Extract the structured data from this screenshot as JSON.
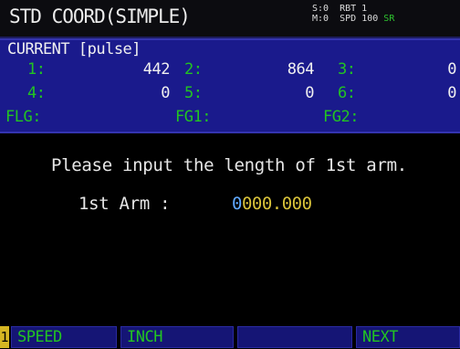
{
  "window": {
    "title": "STD COORD(SIMPLE)"
  },
  "status": {
    "line1": "S:0  RBT 1",
    "line2_left": "M:0  SPD",
    "line2_value": "100",
    "line2_extra": "SR"
  },
  "current": {
    "title": "CURRENT [pulse]",
    "axes": [
      {
        "label": "1:",
        "value": "442"
      },
      {
        "label": "2:",
        "value": "864"
      },
      {
        "label": "3:",
        "value": "0"
      },
      {
        "label": "4:",
        "value": "0"
      },
      {
        "label": "5:",
        "value": "0"
      },
      {
        "label": "6:",
        "value": "0"
      }
    ],
    "flags": [
      {
        "label": "FLG:"
      },
      {
        "label": "FG1:"
      },
      {
        "label": "FG2:"
      }
    ]
  },
  "prompt": {
    "message": "Please input the length of 1st arm.",
    "field_label": "1st Arm :",
    "field_value_cursor": "0",
    "field_value_rest": "000.000"
  },
  "fkeys": {
    "num": "1",
    "f1": "SPEED",
    "f2": "INCH",
    "f3": "",
    "f4": "NEXT"
  },
  "colors": {
    "panel_bg": "#1a1a8c",
    "label_green": "#22c422",
    "value_yellow": "#d8c23a",
    "cursor_blue": "#5fa8ff",
    "fkey_bg": "#151575"
  }
}
